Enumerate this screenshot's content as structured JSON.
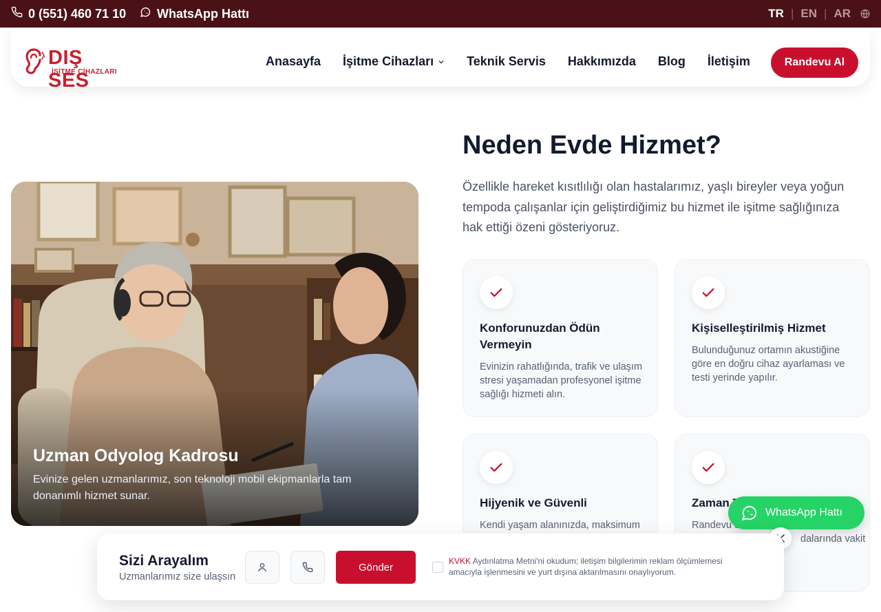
{
  "topbar": {
    "phone": "0 (551) 460 71 10",
    "whatsapp": "WhatsApp Hattı",
    "languages": {
      "tr": "TR",
      "en": "EN",
      "ar": "AR",
      "sep": "|"
    }
  },
  "header": {
    "logo": {
      "name": "DIŞ SES",
      "sub": "İŞİTME CİHAZLARI"
    },
    "nav": [
      "Anasayfa",
      "İşitme Cihazları",
      "Teknik Servis",
      "Hakkımızda",
      "Blog",
      "İletişim"
    ],
    "cta": "Randevu Al"
  },
  "hero": {
    "photo_title": "Uzman Odyolog Kadrosu",
    "photo_text": "Evinize gelen uzmanlarımız, son teknoloji mobil ekipmanlarla tam donanımlı hizmet sunar."
  },
  "main": {
    "title": "Neden Evde Hizmet?",
    "lead": "Özellikle hareket kısıtlılığı olan hastalarımız, yaşlı bireyler veya yoğun tempoda çalışanlar için geliştirdiğimiz bu hizmet ile işitme sağlığınıza hak ettiği özeni gösteriyoruz.",
    "features": [
      {
        "title": "Konforunuzdan Ödün Vermeyin",
        "text": "Evinizin rahatlığında, trafik ve ulaşım stresi yaşamadan profesyonel işitme sağlığı hizmeti alın."
      },
      {
        "title": "Kişiselleştirilmiş Hizmet",
        "text": "Bulunduğunuz ortamın akustiğine göre en doğru cihaz ayarlaması ve testi yerinde yapılır."
      },
      {
        "title": "Hijyenik ve Güvenli",
        "text": "Kendi yaşam alanınızda, maksimum"
      },
      {
        "title": "Zaman T",
        "text": "Randevu s",
        "text2": "dalarında vakit"
      }
    ]
  },
  "whatsapp_float": {
    "label": "WhatsApp Hattı"
  },
  "callback": {
    "title": "Sizi Arayalım",
    "subtitle": "Uzmanlarımız size ulaşsın",
    "send": "Gönder",
    "kvkk": "KVKK",
    "consent": " Aydınlatma Metni'ni okudum; iletişim bilgilerimin reklam ölçümlemesi amacıyla işlenmesini ve yurt dışına aktarılmasını onaylıyorum."
  },
  "colors": {
    "accent": "#c8102e",
    "topbar": "#4a1216",
    "whatsapp": "#25d366",
    "text": "#141a2e"
  },
  "icons": [
    "phone-icon",
    "whatsapp-icon",
    "globe-icon",
    "chevron-down-icon",
    "check-icon",
    "user-icon",
    "close-icon"
  ]
}
